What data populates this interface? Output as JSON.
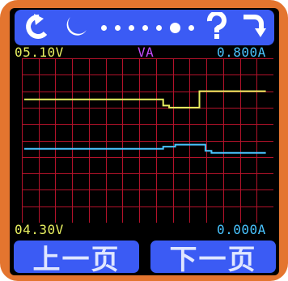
{
  "toolbar": {
    "icons": [
      "rotate-left-icon",
      "sleep-icon",
      "page-dots",
      "help-icon",
      "rotate-right-icon"
    ],
    "dot_count": 7,
    "active_dot_index": 5
  },
  "readings": {
    "voltage_max": "05.10V",
    "mode": "VA",
    "current_max": "0.800A",
    "voltage_min": "04.30V",
    "current_min": "0.000A"
  },
  "colors": {
    "voltage_trace": "#e8f060",
    "current_trace": "#49c4ff",
    "mode_label": "#c64bff",
    "grid": "#b3122a",
    "button": "#3b5bf4",
    "frame": "#e4752f"
  },
  "buttons": {
    "prev_label": "上一页",
    "next_label": "下一页"
  },
  "chart_data": {
    "type": "line",
    "title": "",
    "xlabel": "",
    "ylabel": "",
    "series": [
      {
        "values": [
          4.9,
          4.9,
          4.9,
          4.9,
          4.9,
          4.9,
          4.9,
          4.9,
          4.9,
          4.9,
          4.9,
          4.9,
          4.9,
          4.9,
          4.9,
          4.9,
          4.9,
          4.9,
          4.9,
          4.9,
          4.9,
          4.9,
          4.9,
          4.87,
          4.86,
          4.86,
          4.86,
          4.86,
          4.86,
          4.94,
          4.94,
          4.94,
          4.94,
          4.94,
          4.94,
          4.94,
          4.94,
          4.94,
          4.94,
          4.94,
          4.94
        ]
      },
      {
        "values": [
          0.36,
          0.36,
          0.36,
          0.36,
          0.36,
          0.36,
          0.36,
          0.36,
          0.36,
          0.36,
          0.36,
          0.36,
          0.36,
          0.36,
          0.36,
          0.36,
          0.36,
          0.36,
          0.36,
          0.36,
          0.36,
          0.36,
          0.36,
          0.37,
          0.37,
          0.38,
          0.38,
          0.38,
          0.38,
          0.38,
          0.35,
          0.34,
          0.34,
          0.34,
          0.34,
          0.34,
          0.34,
          0.34,
          0.34,
          0.34,
          0.34
        ]
      }
    ],
    "grid": true
  }
}
